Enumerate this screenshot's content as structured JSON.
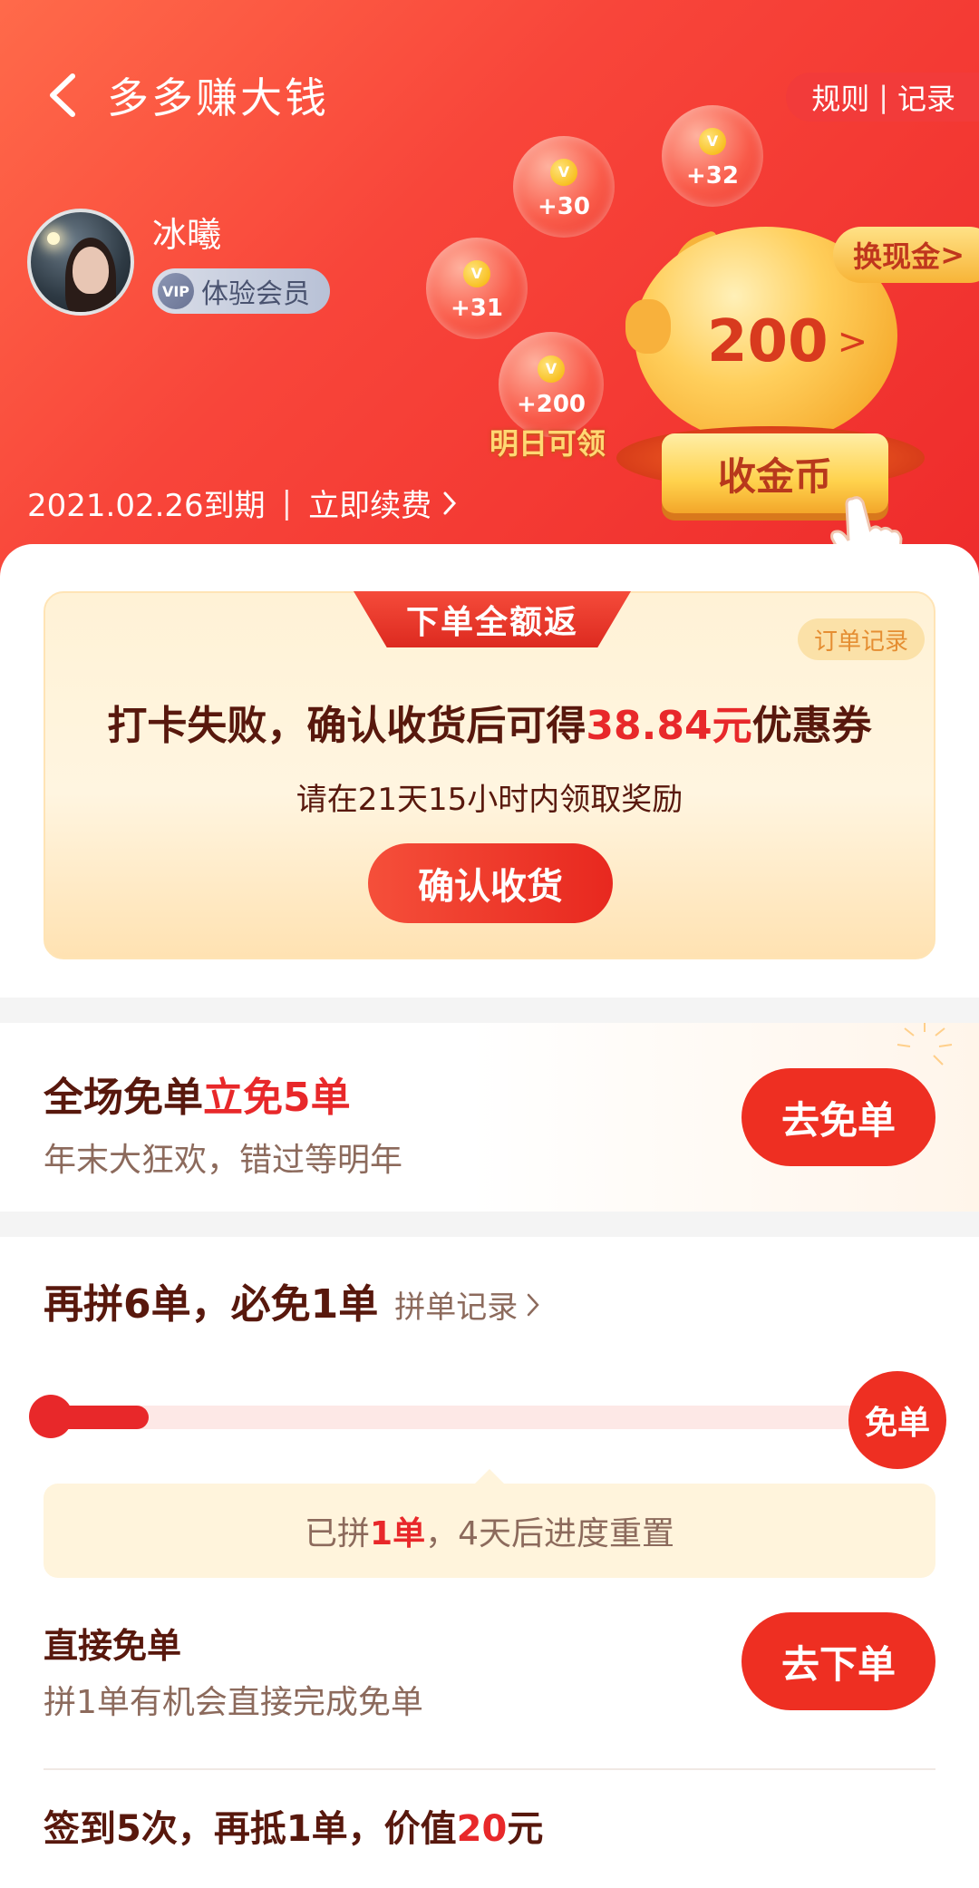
{
  "header": {
    "title": "多多赚大钱",
    "rules_label": "规则",
    "rules_sep": "|",
    "records_label": "记录",
    "username": "冰曦",
    "vip_icon_text": "VIP",
    "vip_label": "体验会员",
    "expiry_text": "2021.02.26到期",
    "expiry_sep": "|",
    "renew_label": "立即续费",
    "coins": [
      {
        "amount": "+30",
        "symbol": "V"
      },
      {
        "amount": "+32",
        "symbol": "V"
      },
      {
        "amount": "+31",
        "symbol": "V"
      },
      {
        "amount": "+200",
        "symbol": "V"
      }
    ],
    "tomorrow_label": "明日可领",
    "exchange_label": "换现金",
    "exchange_arrow": ">",
    "piggy_value": "200",
    "piggy_arrow": ">",
    "collect_label": "收金币"
  },
  "rebate": {
    "ribbon": "下单全额返",
    "order_record": "订单记录",
    "title_prefix": "打卡失败，确认收货后可得",
    "title_amount": "38.84元",
    "title_suffix": "优惠券",
    "subtitle": "请在21天15小时内领取奖励",
    "confirm_button": "确认收货"
  },
  "free_promo": {
    "title_prefix": "全场免单",
    "title_highlight": "立免5单",
    "subtitle": "年末大狂欢，错过等明年",
    "button": "去免单"
  },
  "group": {
    "title": "再拼6单，必免1单",
    "record_label": "拼单记录",
    "progress": {
      "done": 1,
      "total": 7,
      "fraction": 0.14
    },
    "free_circle": "免单",
    "note_prefix": "已拼",
    "note_count": "1单",
    "note_suffix": "，4天后进度重置",
    "direct_title": "直接免单",
    "direct_sub": "拼1单有机会直接完成免单",
    "direct_button": "去下单",
    "sign_prefix": "签到5次，再抵1单，价值",
    "sign_amount": "20",
    "sign_suffix": "元"
  },
  "colors": {
    "brand_red": "#e8282a",
    "header_red": "#f8453a",
    "text_brown": "#58180d",
    "gold": "#ffd24d"
  }
}
